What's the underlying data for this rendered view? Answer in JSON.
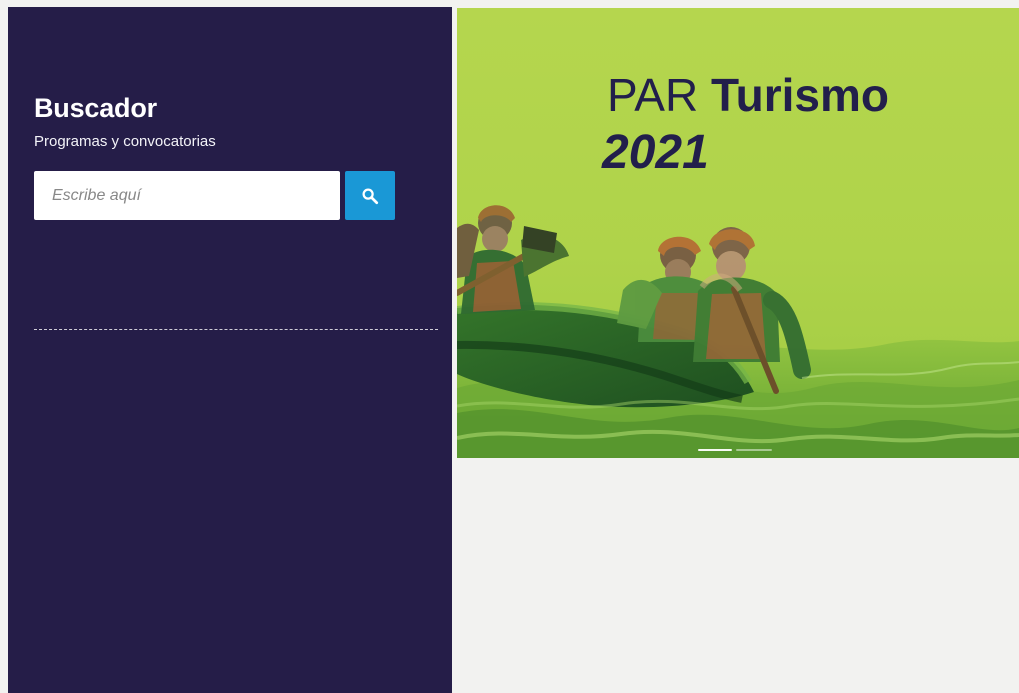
{
  "search": {
    "title": "Buscador",
    "subtitle": "Programas y convocatorias",
    "placeholder": "Escribe aquí",
    "button_icon": "search-icon"
  },
  "banner": {
    "title_prefix": "PAR",
    "title_emphasis": "Turismo",
    "year": "2021",
    "image_icon": "rafting-photo"
  },
  "colors": {
    "sidebar_background": "#251d48",
    "search_button": "#1a98d6",
    "banner_background": "#b5d64e",
    "banner_text": "#221f4b"
  }
}
